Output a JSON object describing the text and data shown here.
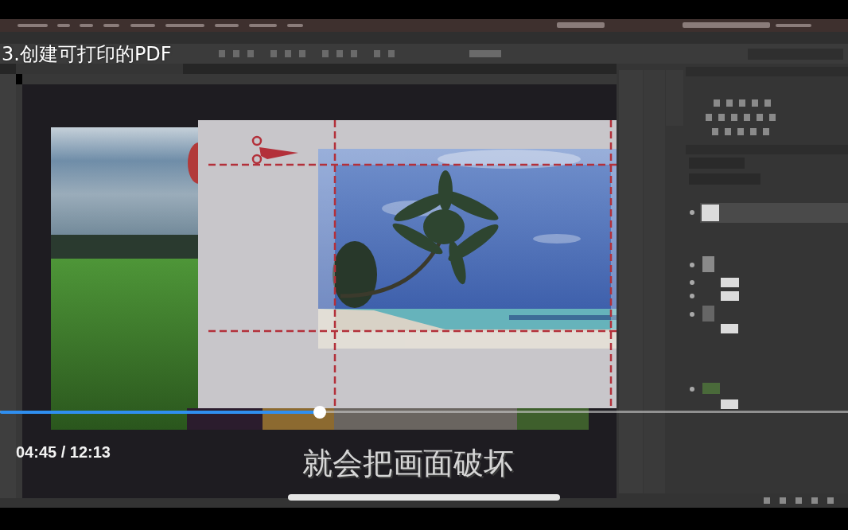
{
  "player": {
    "title": "3.创建可打印的PDF",
    "progress": {
      "level": 0.377
    },
    "time": "04:45 / 12:13",
    "subtitle": "就会把画面破坏"
  }
}
